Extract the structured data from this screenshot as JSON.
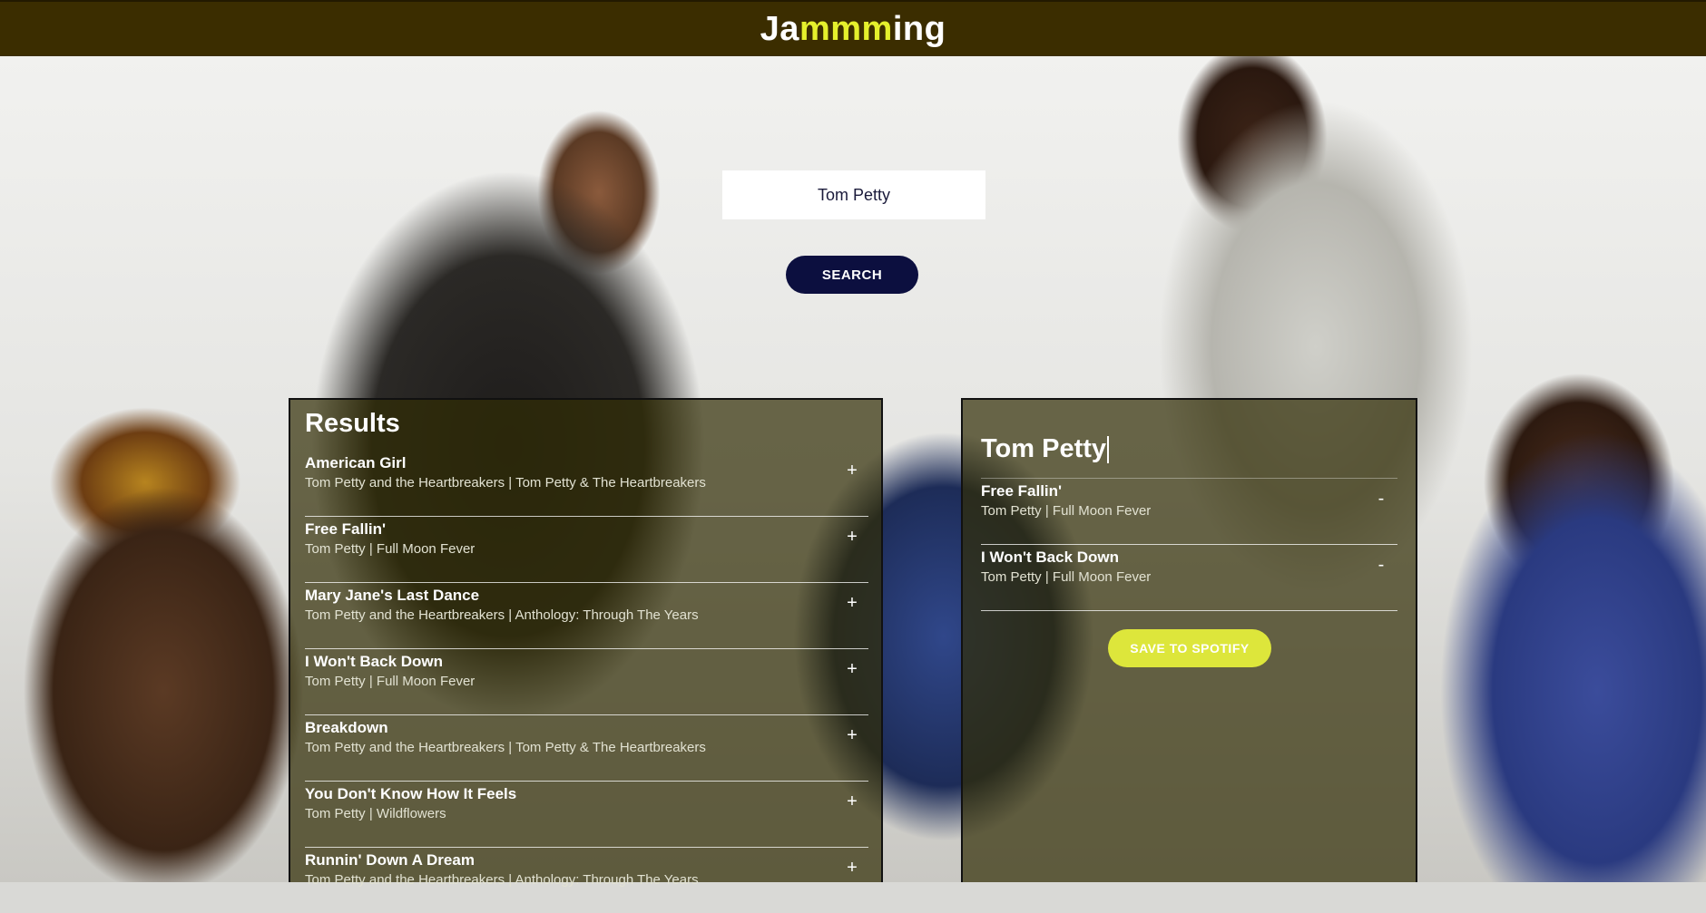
{
  "app": {
    "logo_part1": "Ja",
    "logo_part2": "mmm",
    "logo_part3": "ing",
    "header_color": "#3b2d00",
    "accent_color": "#e5f02c"
  },
  "search": {
    "value": "Tom Petty",
    "button_label": "SEARCH"
  },
  "results": {
    "title": "Results",
    "tracks": [
      {
        "name": "American Girl",
        "info": "Tom Petty and the Heartbreakers | Tom Petty & The Heartbreakers",
        "action": "+"
      },
      {
        "name": "Free Fallin'",
        "info": "Tom Petty | Full Moon Fever",
        "action": "+"
      },
      {
        "name": "Mary Jane's Last Dance",
        "info": "Tom Petty and the Heartbreakers | Anthology: Through The Years",
        "action": "+"
      },
      {
        "name": "I Won't Back Down",
        "info": "Tom Petty | Full Moon Fever",
        "action": "+"
      },
      {
        "name": "Breakdown",
        "info": "Tom Petty and the Heartbreakers | Tom Petty & The Heartbreakers",
        "action": "+"
      },
      {
        "name": "You Don't Know How It Feels",
        "info": "Tom Petty | Wildflowers",
        "action": "+"
      },
      {
        "name": "Runnin' Down A Dream",
        "info": "Tom Petty and the Heartbreakers | Anthology: Through The Years",
        "action": "+"
      }
    ]
  },
  "playlist": {
    "name": "Tom Petty",
    "tracks": [
      {
        "name": "Free Fallin'",
        "info": "Tom Petty | Full Moon Fever",
        "action": "-"
      },
      {
        "name": "I Won't Back Down",
        "info": "Tom Petty | Full Moon Fever",
        "action": "-"
      }
    ],
    "save_label": "SAVE TO SPOTIFY"
  }
}
